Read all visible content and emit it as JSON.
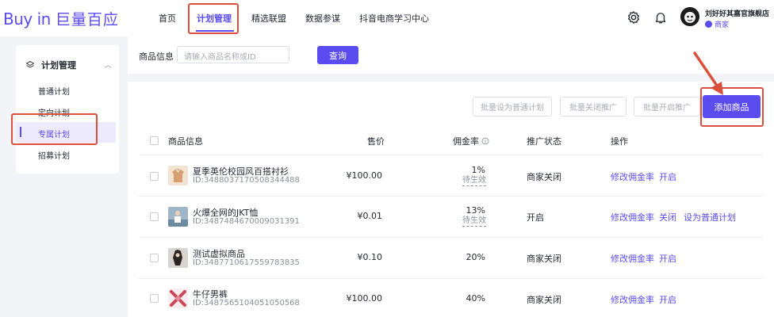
{
  "header": {
    "logo_en": "Buy in",
    "logo_cn": "巨量百应",
    "nav": [
      "首页",
      "计划管理",
      "精选联盟",
      "数据参谋",
      "抖音电商学习中心"
    ],
    "active_nav": "计划管理",
    "user_name": "刘好好其嘉官旗舰店",
    "user_role": "商家"
  },
  "sidebar": {
    "group": "计划管理",
    "items": [
      "普通计划",
      "定向计划",
      "专属计划",
      "招募计划"
    ],
    "active": "专属计划"
  },
  "search": {
    "label": "商品信息",
    "placeholder": "请输入商品名称或ID",
    "button": "查询"
  },
  "toolbar": {
    "bulk_normal": "批量设为普通计划",
    "bulk_close": "批量关闭推广",
    "bulk_open": "批量开启推广",
    "add": "添加商品"
  },
  "table": {
    "columns": [
      "商品信息",
      "售价",
      "佣金率",
      "推广状态",
      "操作"
    ],
    "rows": [
      {
        "name": "夏季英伦校园风百搭衬衫",
        "id": "ID:3488037170508344488",
        "price": "¥100.00",
        "rate": "1%",
        "rate_note": "待生效",
        "status": "商家关闭",
        "actions": [
          "修改佣金率",
          "开启"
        ]
      },
      {
        "name": "火爆全网的JKT恤",
        "id": "ID:3487484670009031391",
        "price": "¥0.01",
        "rate": "13%",
        "rate_note": "待生效",
        "status": "开启",
        "actions": [
          "修改佣金率",
          "关闭",
          "设为普通计划"
        ]
      },
      {
        "name": "测试虚拟商品",
        "id": "ID:3487710617559783835",
        "price": "¥0.10",
        "rate": "20%",
        "rate_note": "",
        "status": "商家关闭",
        "actions": [
          "修改佣金率",
          "开启"
        ]
      },
      {
        "name": "牛仔男裤",
        "id": "ID:3487565104051050568",
        "price": "¥100.00",
        "rate": "40%",
        "rate_note": "",
        "status": "商家关闭",
        "actions": [
          "修改佣金率",
          "开启"
        ]
      }
    ]
  },
  "colors": {
    "accent": "#5b4cf0",
    "highlight": "#d9503c",
    "active_bg": "#eeeafe"
  },
  "icons": [
    "gear-icon",
    "bell-icon",
    "layers-icon",
    "chevron-up-icon",
    "info-icon",
    "user-tag-icon"
  ]
}
